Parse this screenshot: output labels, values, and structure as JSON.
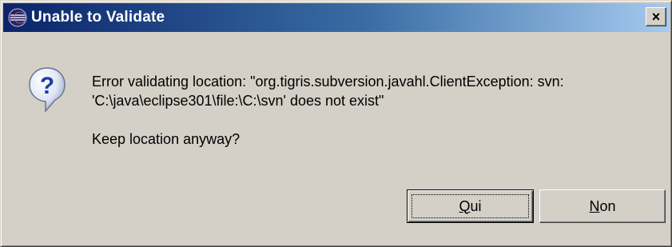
{
  "window": {
    "title": "Unable to Validate",
    "close_glyph": "×",
    "app_icon": "eclipse-icon",
    "title_gradient_start": "#0a246a",
    "title_gradient_end": "#a6caf0",
    "background": "#d4d0c8"
  },
  "dialog": {
    "icon": "question-icon",
    "message_lines": [
      "Error validating location: \"org.tigris.subversion.javahl.ClientException: svn:",
      "'C:\\java\\eclipse301\\file:\\C:\\svn' does not exist\""
    ],
    "prompt": "Keep location anyway?"
  },
  "buttons": {
    "yes": {
      "mnemonic": "Q",
      "rest": "ui",
      "is_default": true
    },
    "no": {
      "mnemonic": "N",
      "rest": "on",
      "is_default": false
    }
  }
}
